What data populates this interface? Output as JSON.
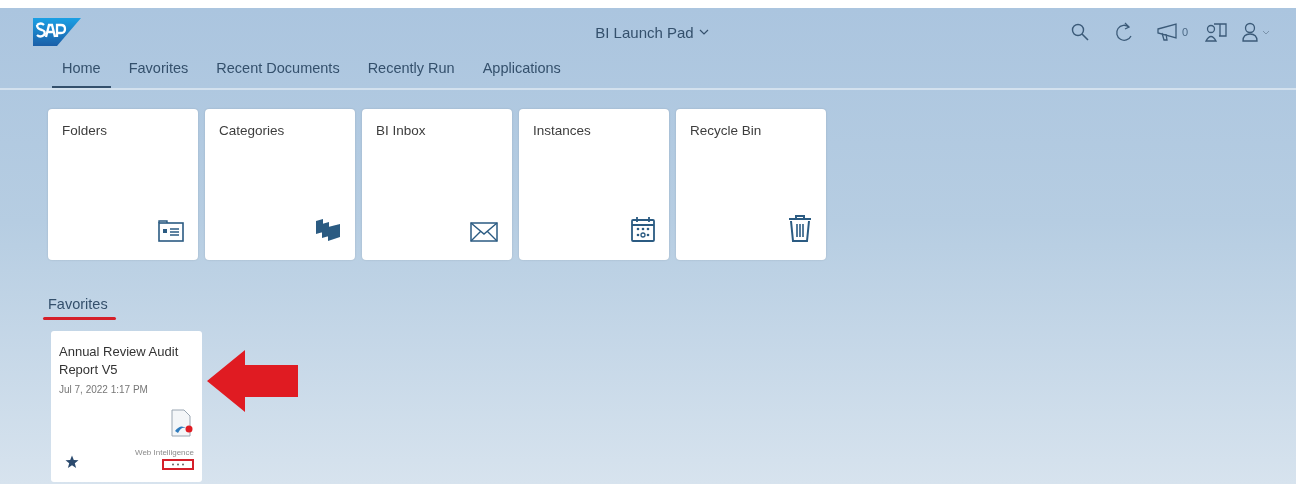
{
  "header": {
    "title": "BI Launch Pad",
    "notification_count": "0"
  },
  "tabs": [
    {
      "label": "Home",
      "selected": true
    },
    {
      "label": "Favorites",
      "selected": false
    },
    {
      "label": "Recent Documents",
      "selected": false
    },
    {
      "label": "Recently Run",
      "selected": false
    },
    {
      "label": "Applications",
      "selected": false
    }
  ],
  "tiles": [
    {
      "label": "Folders",
      "kind": "folders"
    },
    {
      "label": "Categories",
      "kind": "categories"
    },
    {
      "label": "BI Inbox",
      "kind": "inbox"
    },
    {
      "label": "Instances",
      "kind": "instances"
    },
    {
      "label": "Recycle Bin",
      "kind": "recycle"
    }
  ],
  "favorites": {
    "heading": "Favorites",
    "items": [
      {
        "title": "Annual Review Audit Report V5",
        "date": "Jul 7, 2022 1:17 PM",
        "type": "Web Intelligence",
        "favorite": true
      }
    ]
  }
}
